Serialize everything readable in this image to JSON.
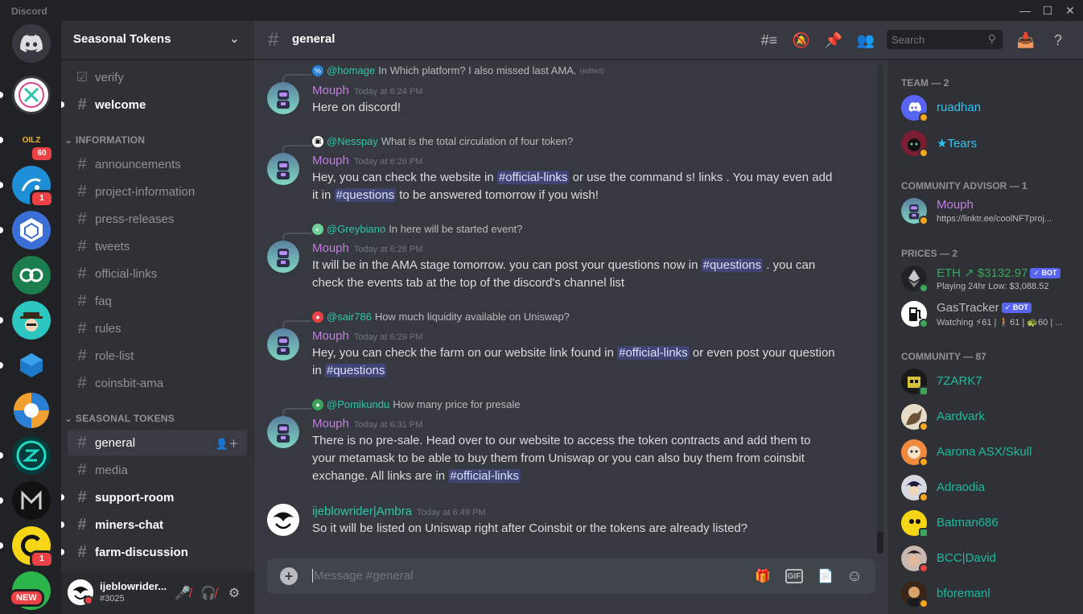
{
  "app": {
    "title": "Discord"
  },
  "server": {
    "name": "Seasonal Tokens"
  },
  "guilds": [
    {
      "name": "discord-home",
      "badge": null
    },
    {
      "name": "guild-x",
      "badge": null
    },
    {
      "name": "oilz",
      "label": "OILZ",
      "badge": "60"
    },
    {
      "name": "guild-blue-swirl",
      "badge": "1"
    },
    {
      "name": "guild-hex",
      "badge": null
    },
    {
      "name": "guild-link",
      "badge": null
    },
    {
      "name": "guild-cowboy",
      "badge": null
    },
    {
      "name": "guild-cube",
      "badge": null
    },
    {
      "name": "guild-pinwheel",
      "badge": null
    },
    {
      "name": "guild-green-circle",
      "badge": null
    },
    {
      "name": "guild-m",
      "badge": null
    },
    {
      "name": "guild-yellow-c",
      "badge": "1"
    },
    {
      "name": "guild-new",
      "label": "NEW",
      "badge": null
    }
  ],
  "channels": {
    "top": [
      {
        "label": "verify",
        "icon": "checkbox"
      },
      {
        "label": "welcome",
        "unread": true
      }
    ],
    "info_category": "INFORMATION",
    "info": [
      "announcements",
      "project-information",
      "press-releases",
      "tweets",
      "official-links",
      "faq",
      "rules",
      "role-list",
      "coinsbit-ama"
    ],
    "seasonal_category": "SEASONAL TOKENS",
    "seasonal": [
      {
        "label": "general",
        "selected": true
      },
      {
        "label": "media"
      },
      {
        "label": "support-room",
        "unread": true
      },
      {
        "label": "miners-chat",
        "unread": true
      },
      {
        "label": "farm-discussion",
        "unread": true
      }
    ]
  },
  "user": {
    "name": "ijeblowrider...",
    "tag": "#3025"
  },
  "header": {
    "channel": "general",
    "search_placeholder": "Search"
  },
  "messages": [
    {
      "reply_to": "@homage",
      "reply_text": "In Which platform? I also missed last AMA.",
      "reply_edited": "(edited)",
      "author": "Mouph",
      "time": "Today at 6:24 PM",
      "text": [
        "Here on discord!"
      ]
    },
    {
      "reply_to": "@Nesspay",
      "reply_text": "What is the total circulation of four token?",
      "author": "Mouph",
      "time": "Today at 6:26 PM",
      "text": [
        "Hey, you can check the website in ",
        "official-links",
        " or use the command s! links . You may even add it in ",
        "questions",
        " to be answered tomorrow if you wish!"
      ]
    },
    {
      "reply_to": "@Greybiano",
      "reply_text": "In here will be started event?",
      "author": "Mouph",
      "time": "Today at 6:28 PM",
      "text": [
        "It will be in the AMA stage tomorrow. you can post your questions now in ",
        "questions",
        " . you can check the events tab at the top of the discord's channel list"
      ]
    },
    {
      "reply_to": "@sair786",
      "reply_text": "How much liquidity available on Uniswap?",
      "author": "Mouph",
      "time": "Today at 6:29 PM",
      "text": [
        "Hey, you can check the farm on our website link found in ",
        "official-links",
        " or even post your question in ",
        "questions",
        ""
      ]
    },
    {
      "reply_to": "@Pomikundu",
      "reply_text": "How many price for presale",
      "author": "Mouph",
      "time": "Today at 6:31 PM",
      "text": [
        "There is no pre-sale. Head over to our website to access the token contracts and add them to your metamask to be able to buy them from Uniswap or you can also buy them from coinsbit exchange. All links are in ",
        "official-links",
        ""
      ]
    },
    {
      "author": "ijeblowrider|Ambra",
      "time": "Today at 6:49 PM",
      "text": [
        "So it will be listed on Uniswap right after Coinsbit or the tokens are already listed?"
      ]
    }
  ],
  "composer": {
    "placeholder": "Message #general",
    "gif": "GIF"
  },
  "members": {
    "team_header": "TEAM — 2",
    "team": [
      {
        "name": "ruadhan"
      },
      {
        "name": "★Tears"
      }
    ],
    "advisor_header": "COMMUNITY ADVISOR — 1",
    "advisor": [
      {
        "name": "Mouph",
        "sub": "https://linktr.ee/coolNFTproj..."
      }
    ],
    "prices_header": "PRICES — 2",
    "prices": [
      {
        "name": "ETH ↗ $3132.97",
        "bot": "✓ BOT",
        "sub": "Playing 24hr Low: $3,088.52"
      },
      {
        "name": "GasTracker",
        "bot": "✓ BOT",
        "sub": "Watching ⚡61 | 🚶61 | 🐢60 | ..."
      }
    ],
    "community_header": "COMMUNITY — 87",
    "community": [
      {
        "name": "7ZARK7"
      },
      {
        "name": "Aardvark"
      },
      {
        "name": "Aarona ASX/Skull"
      },
      {
        "name": "Adraodia"
      },
      {
        "name": "Batman686"
      },
      {
        "name": "BCC|David"
      },
      {
        "name": "bforemanl"
      }
    ]
  },
  "colors": {
    "accent": "#5865f2",
    "mouph": "#c27ee0",
    "team": "#2ec4f1",
    "community": "#1abc9c",
    "mention_name": "#2dc7a8",
    "bg_main": "#36393f",
    "bg_sidebar": "#2f3136",
    "bg_guilds": "#202225"
  }
}
